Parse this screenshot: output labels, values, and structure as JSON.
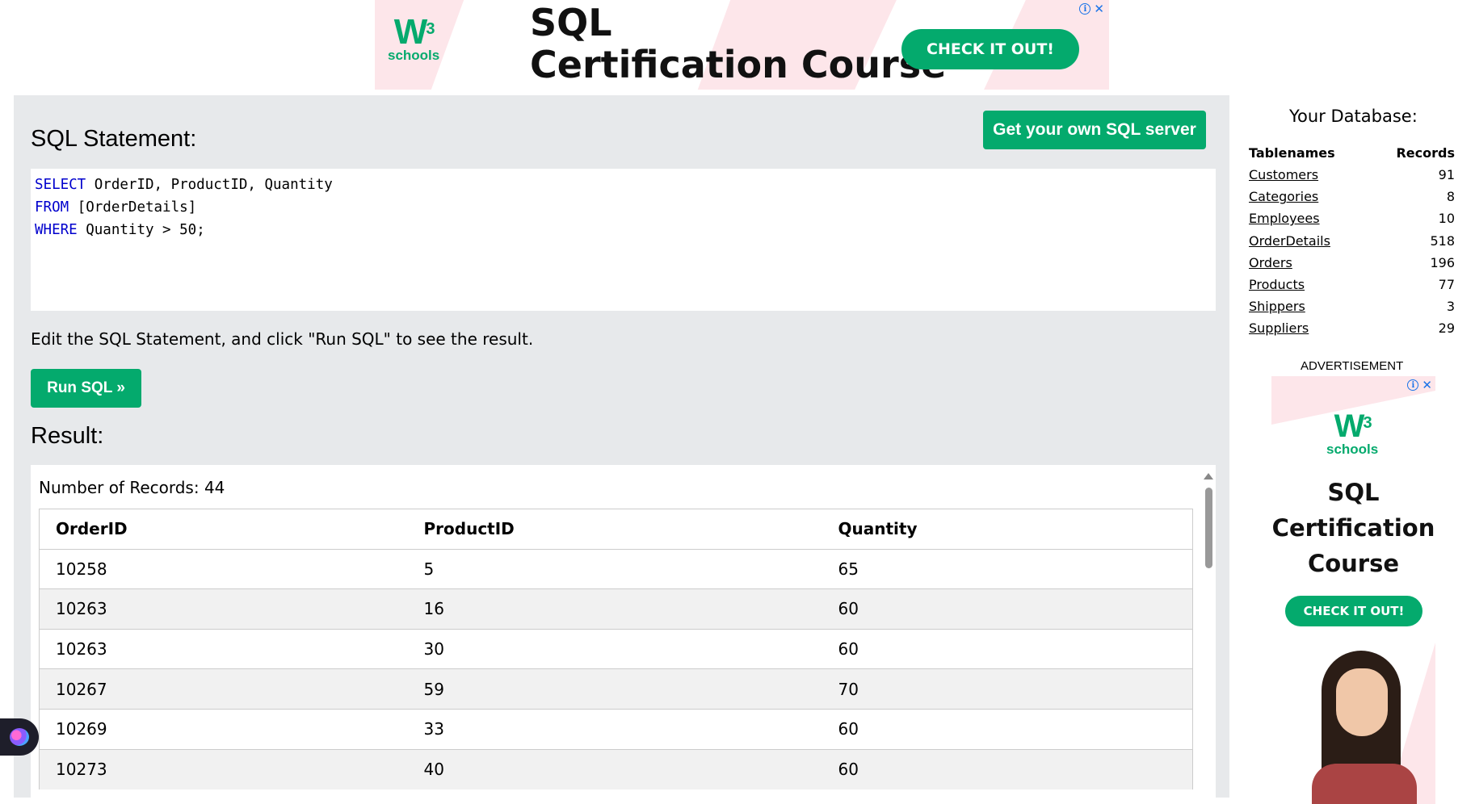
{
  "top_ad": {
    "logo_mark": "W",
    "logo_sup": "3",
    "logo_word": "schools",
    "title_line1": "SQL",
    "title_line2": "Certification Course",
    "cta": "CHECK IT OUT!",
    "info_icon": "i",
    "close_icon": "✕"
  },
  "editor_panel": {
    "title": "SQL Statement:",
    "own_server_button": "Get your own SQL server",
    "code": {
      "line1_kw": "SELECT",
      "line1_rest": " OrderID, ProductID, Quantity",
      "line2_kw": "FROM",
      "line2_rest": " [OrderDetails]",
      "line3_kw": "WHERE",
      "line3_rest": " Quantity > 50;"
    },
    "hint": "Edit the SQL Statement, and click \"Run SQL\" to see the result.",
    "run_button": "Run SQL »"
  },
  "result": {
    "title": "Result:",
    "record_count_text": "Number of Records: 44",
    "columns": [
      "OrderID",
      "ProductID",
      "Quantity"
    ],
    "rows": [
      [
        "10258",
        "5",
        "65"
      ],
      [
        "10263",
        "16",
        "60"
      ],
      [
        "10263",
        "30",
        "60"
      ],
      [
        "10267",
        "59",
        "70"
      ],
      [
        "10269",
        "33",
        "60"
      ],
      [
        "10273",
        "40",
        "60"
      ]
    ]
  },
  "sidebar": {
    "title": "Your Database:",
    "col_tablenames": "Tablenames",
    "col_records": "Records",
    "tables": [
      {
        "name": "Customers",
        "records": "91"
      },
      {
        "name": "Categories",
        "records": "8"
      },
      {
        "name": "Employees",
        "records": "10"
      },
      {
        "name": "OrderDetails",
        "records": "518"
      },
      {
        "name": "Orders",
        "records": "196"
      },
      {
        "name": "Products",
        "records": "77"
      },
      {
        "name": "Shippers",
        "records": "3"
      },
      {
        "name": "Suppliers",
        "records": "29"
      }
    ],
    "ad_label": "ADVERTISEMENT",
    "ad": {
      "logo_mark": "W",
      "logo_sup": "3",
      "logo_word": "schools",
      "title_line1": "SQL",
      "title_line2": "Certification",
      "title_line3": "Course",
      "cta": "CHECK IT OUT!",
      "info_icon": "i",
      "close_icon": "✕"
    }
  },
  "colors": {
    "accent_green": "#04aa6d",
    "panel_grey": "#e7e9eb",
    "keyword_blue": "#0000cd",
    "ad_pink": "#fde6ea"
  }
}
